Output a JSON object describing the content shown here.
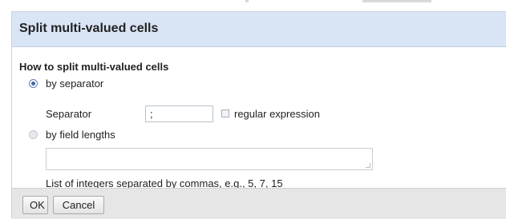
{
  "dialog": {
    "title": "Split multi-valued cells",
    "section_label": "How to split multi-valued cells",
    "option_separator": {
      "label": "by separator",
      "checked": true,
      "field_label": "Separator",
      "value": ";",
      "regex_label": "regular expression",
      "regex_checked": false
    },
    "option_lengths": {
      "label": "by field lengths",
      "checked": false,
      "value": "",
      "hint": "List of integers separated by commas, e.g., 5, 7, 15"
    },
    "buttons": {
      "ok": "OK",
      "cancel": "Cancel"
    }
  },
  "colors": {
    "header_bg": "#d9e4f4",
    "footer_bg": "#e6e6e6",
    "radio_accent": "#3a67ad"
  }
}
